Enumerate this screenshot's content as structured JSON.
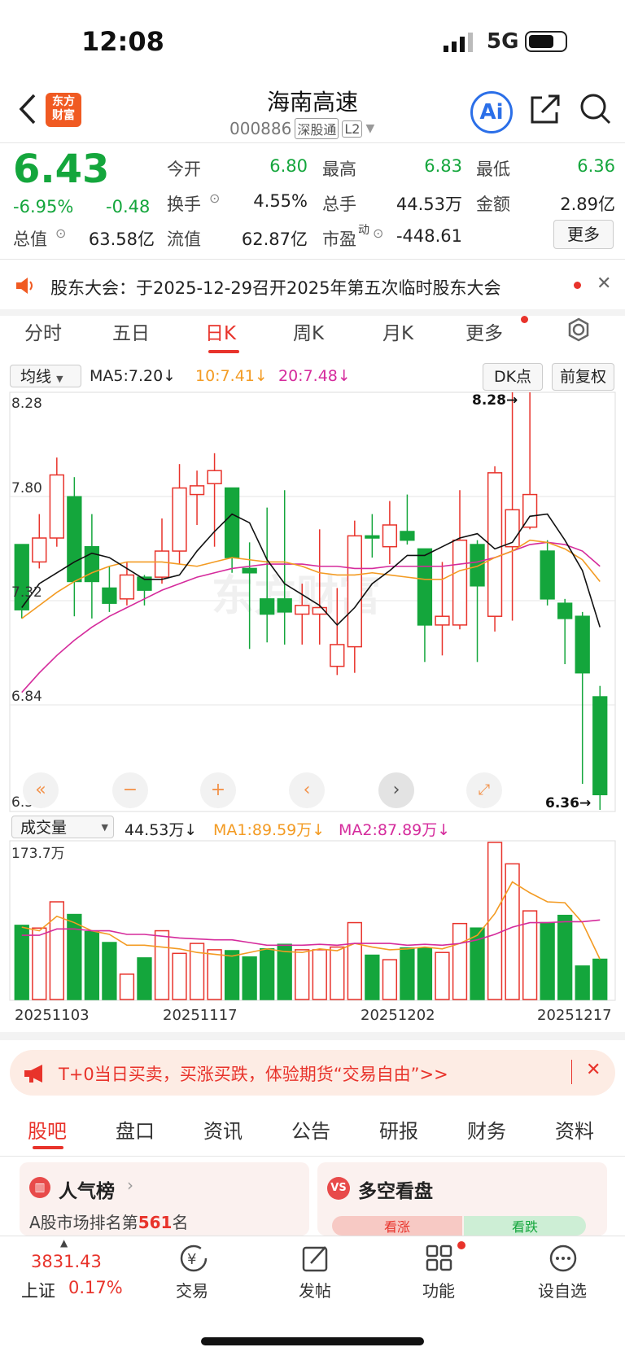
{
  "status": {
    "time": "12:08",
    "network": "5G"
  },
  "header": {
    "title": "海南高速",
    "code": "000886",
    "badge1": "深股通",
    "badge2": "L2",
    "logo_line1": "东方",
    "logo_line2": "财富",
    "ai_label": "Ai"
  },
  "quote": {
    "price": "6.43",
    "change_pct": "-6.95%",
    "change": "-0.48",
    "open_label": "今开",
    "open": "6.80",
    "high_label": "最高",
    "high": "6.83",
    "low_label": "最低",
    "low": "6.36",
    "turnover_label": "换手",
    "turnover": "4.55%",
    "volume_label": "总手",
    "volume": "44.53万",
    "amount_label": "金额",
    "amount": "2.89亿",
    "mktcap_label": "总值",
    "mktcap": "63.58亿",
    "float_label": "流值",
    "float": "62.87亿",
    "pe_label": "市盈",
    "pe_sup": "动",
    "pe": "-448.61",
    "more": "更多"
  },
  "notice": {
    "text": "股东大会：于2025-12-29召开2025年第五次临时股东大会"
  },
  "period_tabs": [
    "分时",
    "五日",
    "日K",
    "周K",
    "月K",
    "更多"
  ],
  "indicator": {
    "select": "均线",
    "ma5": "MA5:7.20↓",
    "ma10": "10:7.41↓",
    "ma20": "20:7.48↓",
    "dk": "DK点",
    "adjust": "前复权"
  },
  "price_axis": {
    "top": "8.28",
    "l2": "7.80",
    "l3": "7.32",
    "l4": "6.84",
    "bottom": "6.36",
    "max_label": "8.28→",
    "min_label": "6.36→"
  },
  "volume_panel": {
    "select": "成交量",
    "vol": "44.53万↓",
    "ma1": "MA1:89.59万↓",
    "ma2": "MA2:87.89万↓",
    "max": "173.7万"
  },
  "dates": [
    "20251103",
    "20251117",
    "20251202",
    "20251217"
  ],
  "chart_data": {
    "type": "candlestick",
    "ylim": [
      6.36,
      8.28
    ],
    "candles": [
      [
        7.58,
        7.28,
        7.58,
        7.24
      ],
      [
        7.5,
        7.61,
        7.72,
        7.47
      ],
      [
        7.61,
        7.9,
        7.98,
        7.57
      ],
      [
        7.8,
        7.41,
        7.89,
        7.25
      ],
      [
        7.57,
        7.41,
        7.72,
        7.24
      ],
      [
        7.38,
        7.31,
        7.48,
        7.27
      ],
      [
        7.33,
        7.44,
        7.5,
        7.3
      ],
      [
        7.43,
        7.37,
        7.44,
        7.3
      ],
      [
        7.43,
        7.55,
        7.7,
        7.4
      ],
      [
        7.55,
        7.84,
        7.95,
        7.49
      ],
      [
        7.81,
        7.85,
        7.92,
        7.67
      ],
      [
        7.86,
        7.92,
        8.0,
        7.57
      ],
      [
        7.84,
        7.52,
        7.84,
        7.45
      ],
      [
        7.47,
        7.45,
        7.59,
        7.1
      ],
      [
        7.33,
        7.26,
        7.75,
        7.13
      ],
      [
        7.33,
        7.27,
        7.83,
        7.12
      ],
      [
        7.26,
        7.3,
        7.4,
        7.12
      ],
      [
        7.26,
        7.29,
        7.65,
        7.12
      ],
      [
        7.02,
        7.12,
        7.38,
        6.98
      ],
      [
        7.11,
        7.62,
        7.69,
        6.99
      ],
      [
        7.62,
        7.61,
        7.72,
        7.52
      ],
      [
        7.57,
        7.67,
        7.78,
        7.49
      ],
      [
        7.64,
        7.6,
        7.81,
        7.58
      ],
      [
        7.56,
        7.21,
        7.56,
        7.04
      ],
      [
        7.21,
        7.25,
        7.5,
        7.07
      ],
      [
        7.21,
        7.6,
        7.83,
        7.19
      ],
      [
        7.58,
        7.39,
        7.6,
        7.04
      ],
      [
        7.25,
        7.91,
        7.94,
        7.18
      ],
      [
        7.57,
        7.74,
        8.28,
        7.23
      ],
      [
        7.66,
        7.81,
        8.28,
        7.65
      ],
      [
        7.55,
        7.33,
        7.6,
        7.3
      ],
      [
        7.31,
        7.24,
        7.33,
        7.03
      ],
      [
        7.25,
        6.99,
        7.27,
        6.48
      ],
      [
        6.88,
        6.43,
        6.93,
        6.36
      ]
    ],
    "ma5": [
      7.29,
      7.4,
      7.45,
      7.5,
      7.54,
      7.52,
      7.47,
      7.42,
      7.42,
      7.44,
      7.55,
      7.64,
      7.72,
      7.68,
      7.51,
      7.4,
      7.35,
      7.3,
      7.21,
      7.29,
      7.4,
      7.46,
      7.53,
      7.53,
      7.57,
      7.61,
      7.63,
      7.56,
      7.59,
      7.71,
      7.72,
      7.6,
      7.46,
      7.2
    ],
    "ma10": [
      7.24,
      7.3,
      7.36,
      7.41,
      7.45,
      7.48,
      7.5,
      7.5,
      7.5,
      7.49,
      7.48,
      7.5,
      7.52,
      7.51,
      7.5,
      7.5,
      7.48,
      7.45,
      7.44,
      7.44,
      7.45,
      7.44,
      7.43,
      7.42,
      7.42,
      7.46,
      7.48,
      7.52,
      7.55,
      7.6,
      7.59,
      7.56,
      7.51,
      7.41
    ],
    "ma20": [
      6.9,
      6.99,
      7.07,
      7.14,
      7.2,
      7.25,
      7.29,
      7.33,
      7.37,
      7.4,
      7.43,
      7.45,
      7.47,
      7.48,
      7.49,
      7.49,
      7.49,
      7.48,
      7.48,
      7.47,
      7.47,
      7.48,
      7.48,
      7.48,
      7.48,
      7.49,
      7.5,
      7.52,
      7.55,
      7.58,
      7.59,
      7.58,
      7.55,
      7.48
    ],
    "volumes": [
      82,
      79,
      108,
      94,
      75,
      63,
      28,
      46,
      76,
      51,
      62,
      55,
      54,
      47,
      56,
      61,
      55,
      55,
      58,
      85,
      49,
      44,
      57,
      57,
      52,
      84,
      79,
      173.7,
      150,
      98,
      85,
      93,
      37,
      44.53
    ],
    "vol_ma1": [
      80,
      76,
      92,
      85,
      76,
      72,
      60,
      60,
      58,
      56,
      52,
      50,
      48,
      52,
      56,
      53,
      52,
      56,
      54,
      62,
      58,
      55,
      56,
      58,
      56,
      62,
      71,
      95,
      130,
      118,
      108,
      107,
      85,
      44.53
    ],
    "vol_ma2": [
      71,
      71,
      78,
      78,
      76,
      76,
      72,
      72,
      70,
      68,
      67,
      66,
      66,
      63,
      60,
      60,
      60,
      61,
      60,
      62,
      62,
      62,
      60,
      61,
      60,
      62,
      66,
      72,
      80,
      85,
      85,
      86,
      86,
      87.89
    ]
  },
  "promo": {
    "text": "T+0当日买卖，买涨买跌，体验期货“交易自由”>>"
  },
  "news_tabs": [
    "股吧",
    "盘口",
    "资讯",
    "公告",
    "研报",
    "财务",
    "资料"
  ],
  "cards": {
    "popular_title": "人气榜",
    "rank_prefix": "A股市场排名第",
    "rank": "561",
    "rank_suffix": "名",
    "duokong_title": "多空看盘",
    "rise": "看涨",
    "fall": "看跌"
  },
  "bottom": {
    "index_value": "3831.43",
    "index_name": "上证",
    "index_pct": "0.17%",
    "tabs": [
      "交易",
      "发帖",
      "功能",
      "设自选"
    ]
  }
}
